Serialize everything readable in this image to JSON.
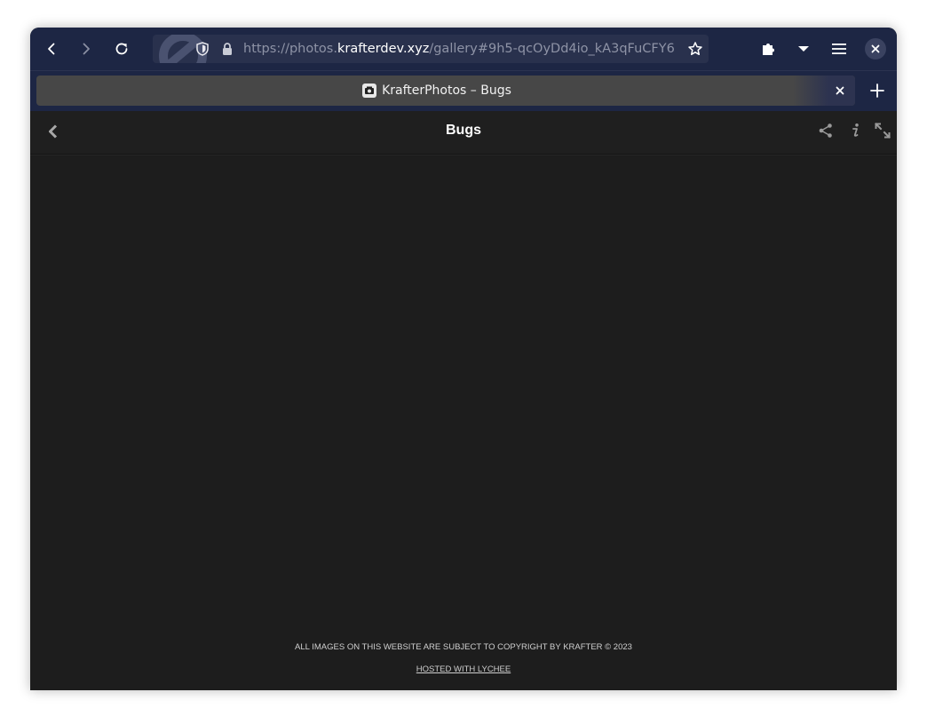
{
  "browser": {
    "url": {
      "prefix": "https://photos.",
      "host": "krafterdev.xyz",
      "path": "/gallery#9h5-qcOyDd4io_kA3qFuCFY6"
    },
    "tab": {
      "title": "KrafterPhotos – Bugs"
    },
    "icons": {
      "back": "back-arrow-icon",
      "forward": "forward-arrow-icon",
      "reload": "reload-icon",
      "shield": "tracking-shield-icon",
      "lock": "lock-icon",
      "star": "bookmark-star-icon",
      "extensions": "puzzle-piece-icon",
      "list_all_tabs": "chevron-down-icon",
      "menu": "hamburger-menu-icon",
      "close": "close-icon",
      "new_tab": "plus-icon"
    },
    "colors": {
      "toolbar": "#1d2644",
      "urlbar": "#29314d",
      "tab": "#474747"
    }
  },
  "page": {
    "header": {
      "title": "Bugs"
    },
    "footer": {
      "copyright": "ALL IMAGES ON THIS WEBSITE ARE SUBJECT TO COPYRIGHT BY KRAFTER © 2023",
      "hosted": "HOSTED WITH LYCHEE"
    },
    "colors": {
      "background": "#1d1d1d",
      "header": "#1f1f1f"
    }
  }
}
